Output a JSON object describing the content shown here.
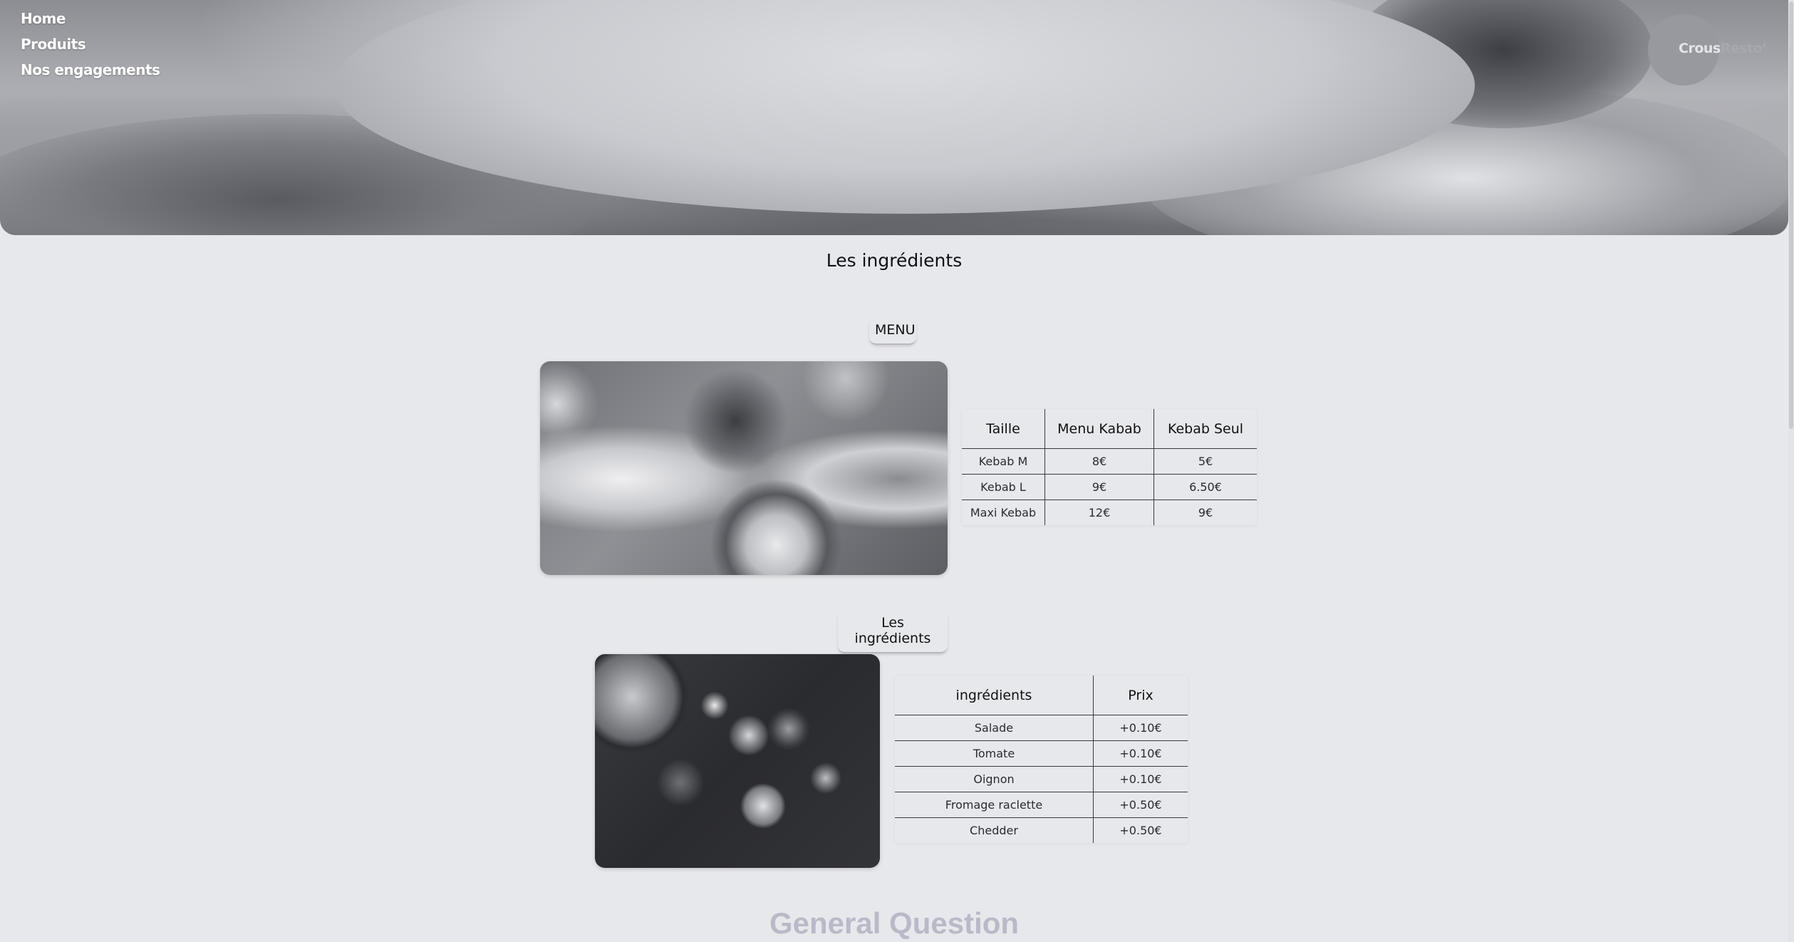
{
  "nav": {
    "items": [
      "Home",
      "Produits",
      "Nos engagements"
    ]
  },
  "logo": {
    "part1": "Crous",
    "part2": "Resto’"
  },
  "page_title": "Les ingrédients",
  "menu_section": {
    "button_label": "MENU",
    "table": {
      "headers": [
        "Taille",
        "Menu Kabab",
        "Kebab Seul"
      ],
      "rows": [
        [
          "Kebab M",
          "8€",
          "5€"
        ],
        [
          "Kebab L",
          "9€",
          "6.50€"
        ],
        [
          "Maxi Kebab",
          "12€",
          "9€"
        ]
      ]
    }
  },
  "ingredients_section": {
    "button_label": "Les ingrédients",
    "table": {
      "headers": [
        "ingrédients",
        "Prix"
      ],
      "rows": [
        [
          "Salade",
          "+0.10€"
        ],
        [
          "Tomate",
          "+0.10€"
        ],
        [
          "Oignon",
          "+0.10€"
        ],
        [
          "Fromage raclette",
          "+0.50€"
        ],
        [
          "Chedder",
          "+0.50€"
        ]
      ]
    }
  },
  "faq_title": "General Question"
}
